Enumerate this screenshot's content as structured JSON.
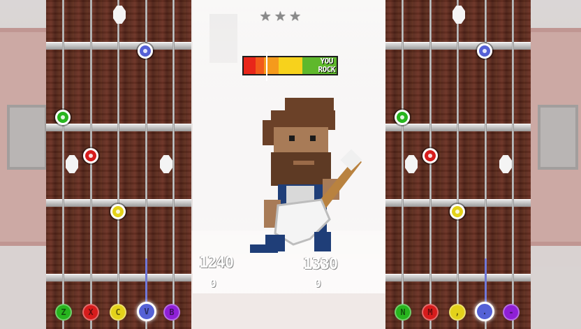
{
  "hud": {
    "stars": [
      "★",
      "★",
      "★"
    ],
    "rock_meter": {
      "label_line1": "YOU",
      "label_line2": "ROCK",
      "colors": [
        "#e8261a",
        "#f25a1a",
        "#f59a1c",
        "#f7d21c",
        "#c4d81e",
        "#5fb82c"
      ]
    },
    "player1": {
      "score": "1240",
      "combo": "0"
    },
    "player2": {
      "score": "1330",
      "combo": "0"
    }
  },
  "left_board": {
    "keys": [
      {
        "label": "Z",
        "color": "#27b51e"
      },
      {
        "label": "X",
        "color": "#d61c1c"
      },
      {
        "label": "C",
        "color": "#e3d21a"
      },
      {
        "label": "V",
        "color": "#5561d6"
      },
      {
        "label": "B",
        "color": "#8f1fd6"
      }
    ]
  },
  "right_board": {
    "keys": [
      {
        "label": "N",
        "color": "#27b51e"
      },
      {
        "label": "M",
        "color": "#d61c1c"
      },
      {
        "label": ",",
        "color": "#e3d21a"
      },
      {
        "label": ".",
        "color": "#5561d6"
      },
      {
        "label": "-",
        "color": "#8f1fd6"
      }
    ]
  }
}
